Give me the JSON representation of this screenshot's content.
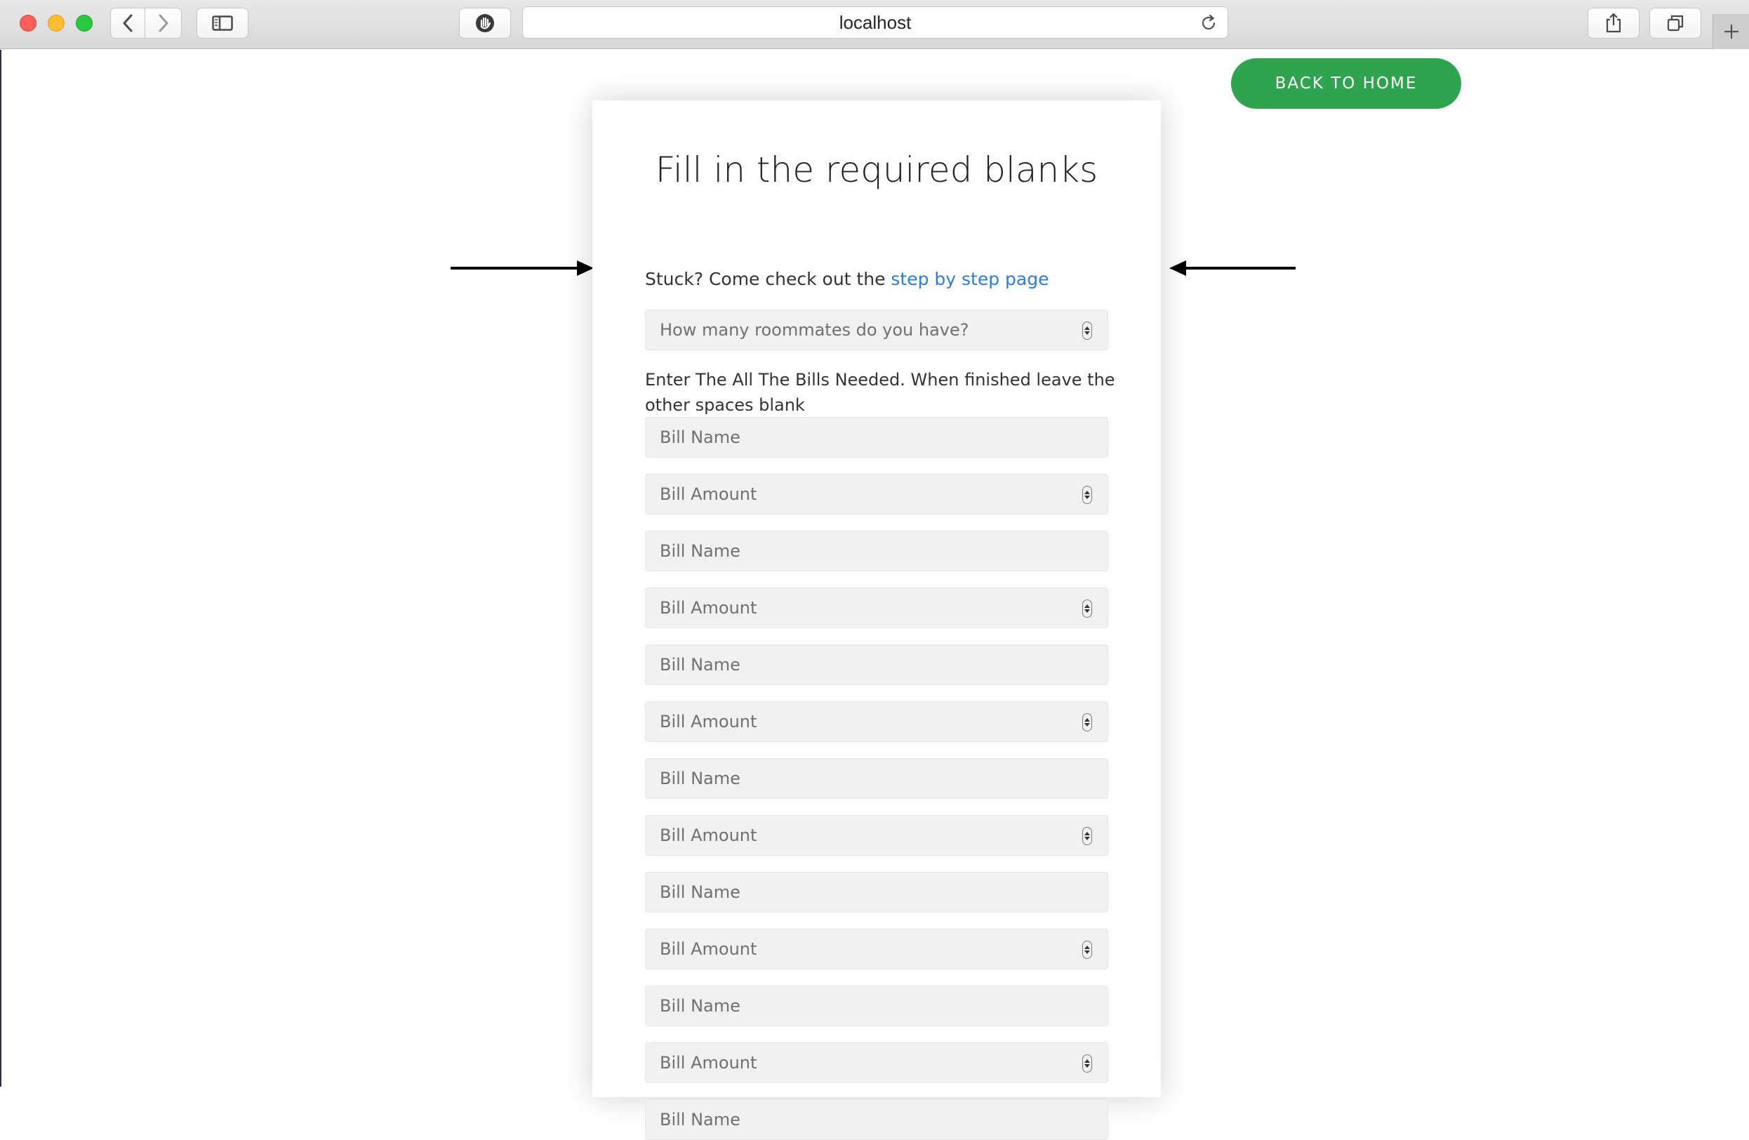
{
  "browser": {
    "url": "localhost"
  },
  "header": {
    "back_home_label": "BACK TO HOME"
  },
  "form": {
    "title": "Fill in the required blanks",
    "stuck_prefix": "Stuck? Come check out the ",
    "stuck_link": "step by step page",
    "roommates_placeholder": "How many roommates do you have?",
    "instructions": "Enter The All The Bills Needed. When finished leave the other spaces blank",
    "bill_name_placeholder": "Bill Name",
    "bill_amount_placeholder": "Bill Amount"
  },
  "colors": {
    "accent_green": "#2ea44f",
    "link_blue": "#2b7de0",
    "field_bg": "#f1f1f1"
  },
  "icons": {
    "back": "chevron-left-icon",
    "forward": "chevron-right-icon",
    "sidebar": "sidebar-icon",
    "shield": "hand-shield-icon",
    "reload": "reload-icon",
    "share": "share-icon",
    "tabs": "tab-overview-icon",
    "new_tab": "plus-icon",
    "pointer_arrows": "arrow-icon"
  }
}
